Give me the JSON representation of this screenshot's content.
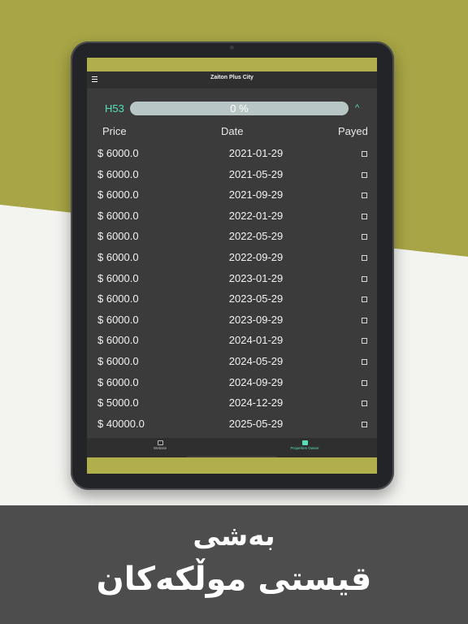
{
  "colors": {
    "olive": "#a7a545",
    "accent": "#55e0b9",
    "app_background": "#3b3b3b",
    "bar_background": "#2f2f2f",
    "caption_band": "#4d4d4d"
  },
  "app": {
    "title": "Zaiton Plus City",
    "menu_icon": "hamburger-menu-icon"
  },
  "unit": {
    "code": "H53",
    "progress_label": "0 %",
    "progress_fraction": 0.0,
    "collapse_icon": "chevron-up-icon"
  },
  "table": {
    "headers": {
      "price": "Price",
      "date": "Date",
      "payed": "Payed"
    },
    "rows": [
      {
        "price": "$ 6000.0",
        "date": "2021-01-29",
        "payed": false
      },
      {
        "price": "$ 6000.0",
        "date": "2021-05-29",
        "payed": false
      },
      {
        "price": "$ 6000.0",
        "date": "2021-09-29",
        "payed": false
      },
      {
        "price": "$ 6000.0",
        "date": "2022-01-29",
        "payed": false
      },
      {
        "price": "$ 6000.0",
        "date": "2022-05-29",
        "payed": false
      },
      {
        "price": "$ 6000.0",
        "date": "2022-09-29",
        "payed": false
      },
      {
        "price": "$ 6000.0",
        "date": "2023-01-29",
        "payed": false
      },
      {
        "price": "$ 6000.0",
        "date": "2023-05-29",
        "payed": false
      },
      {
        "price": "$ 6000.0",
        "date": "2023-09-29",
        "payed": false
      },
      {
        "price": "$ 6000.0",
        "date": "2024-01-29",
        "payed": false
      },
      {
        "price": "$ 6000.0",
        "date": "2024-05-29",
        "payed": false
      },
      {
        "price": "$ 6000.0",
        "date": "2024-09-29",
        "payed": false
      },
      {
        "price": "$ 5000.0",
        "date": "2024-12-29",
        "payed": false
      },
      {
        "price": "$ 40000.0",
        "date": "2025-05-29",
        "payed": false
      }
    ]
  },
  "bottom_nav": {
    "items": [
      {
        "label": "Website",
        "icon": "website-icon",
        "active": false
      },
      {
        "label": "Properties Owner",
        "icon": "properties-owner-icon",
        "active": true
      }
    ]
  },
  "caption": {
    "line1": "بەشی",
    "line2": "قیستی موڵکەکان"
  }
}
